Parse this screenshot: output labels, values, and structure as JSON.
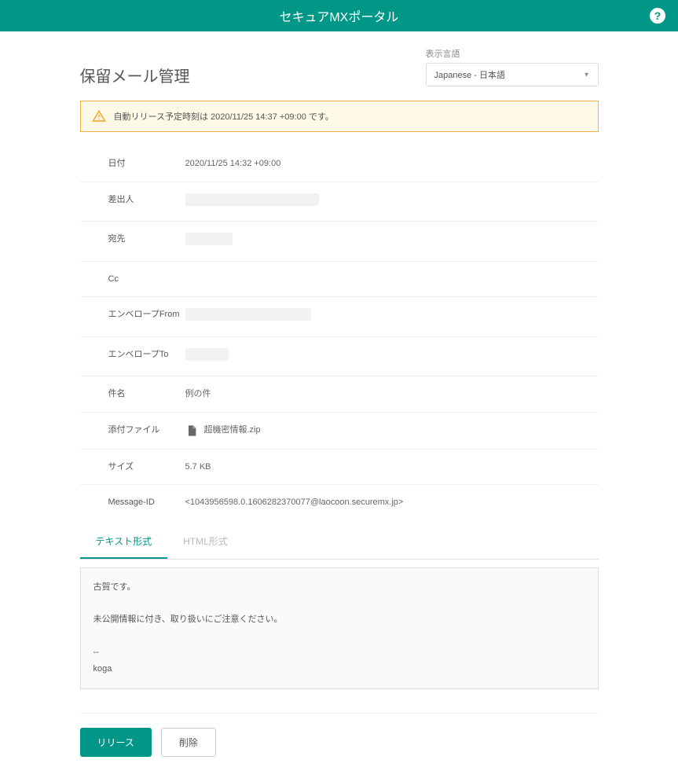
{
  "header": {
    "title": "セキュアMXポータル"
  },
  "page": {
    "title": "保留メール管理"
  },
  "lang": {
    "label": "表示言語",
    "value": "Japanese - 日本語"
  },
  "notice": {
    "text": "自動リリース予定時刻は 2020/11/25 14:37 +09:00 です。"
  },
  "details": {
    "date_label": "日付",
    "date_value": "2020/11/25 14:32 +09:00",
    "from_label": "差出人",
    "to_label": "宛先",
    "cc_label": "Cc",
    "env_from_label": "エンベロープFrom",
    "env_to_label": "エンベロープTo",
    "subject_label": "件名",
    "subject_value": "例の件",
    "attachment_label": "添付ファイル",
    "attachment_value": "超機密情報.zip",
    "size_label": "サイズ",
    "size_value": "5.7 KB",
    "msgid_label": "Message-ID",
    "msgid_value": "<1043956598.0.1606282370077@laocoon.securemx.jp>"
  },
  "tabs": {
    "text": "テキスト形式",
    "html": "HTML形式"
  },
  "body": "古賀です。\n\n未公開情報に付き、取り扱いにご注意ください。\n\n--\nkoga",
  "buttons": {
    "release": "リリース",
    "delete": "削除"
  }
}
